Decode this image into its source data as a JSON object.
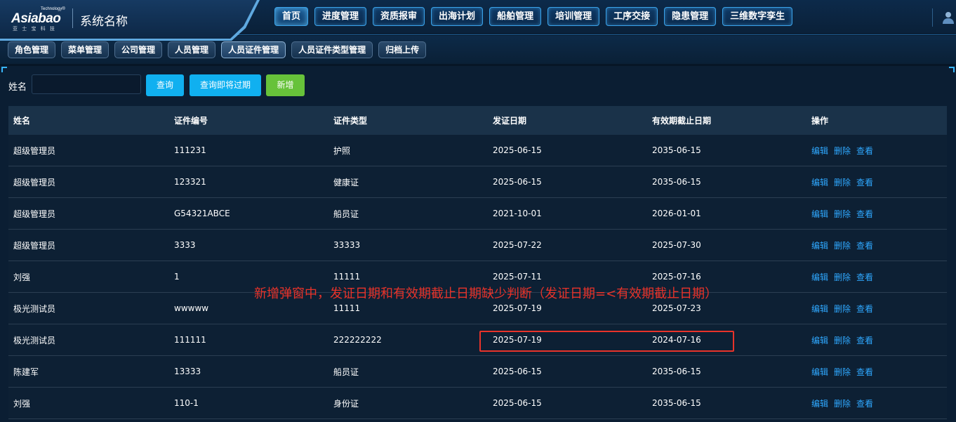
{
  "header": {
    "logo": {
      "tech": "Technology®",
      "brand": "Asiabao",
      "sub": "亚 士 宝 科 技"
    },
    "system_name": "系统名称",
    "nav": [
      {
        "label": "首页",
        "active": true
      },
      {
        "label": "进度管理"
      },
      {
        "label": "资质报审"
      },
      {
        "label": "出海计划"
      },
      {
        "label": "船舶管理"
      },
      {
        "label": "培训管理"
      },
      {
        "label": "工序交接"
      },
      {
        "label": "隐患管理"
      },
      {
        "label": "三维数字孪生"
      }
    ],
    "user_icon": "user-icon"
  },
  "sub_tabs": [
    {
      "label": "角色管理"
    },
    {
      "label": "菜单管理"
    },
    {
      "label": "公司管理"
    },
    {
      "label": "人员管理"
    },
    {
      "label": "人员证件管理",
      "active": true
    },
    {
      "label": "人员证件类型管理"
    },
    {
      "label": "归档上传"
    }
  ],
  "filter": {
    "name_label": "姓名",
    "name_value": "",
    "name_placeholder": "",
    "query_label": "查询",
    "query_expiring_label": "查询即将过期",
    "add_label": "新增"
  },
  "table": {
    "columns": [
      "姓名",
      "证件编号",
      "证件类型",
      "发证日期",
      "有效期截止日期",
      "操作"
    ],
    "actions": [
      "编辑",
      "删除",
      "查看"
    ],
    "rows": [
      [
        "超级管理员",
        "111231",
        "护照",
        "2025-06-15",
        "2035-06-15"
      ],
      [
        "超级管理员",
        "123321",
        "健康证",
        "2025-06-15",
        "2035-06-15"
      ],
      [
        "超级管理员",
        "G54321ABCE",
        "船员证",
        "2021-10-01",
        "2026-01-01"
      ],
      [
        "超级管理员",
        "3333",
        "33333",
        "2025-07-22",
        "2025-07-30"
      ],
      [
        "刘强",
        "1",
        "11111",
        "2025-07-11",
        "2025-07-16"
      ],
      [
        "极光测试员",
        "wwwww",
        "11111",
        "2025-07-19",
        "2025-07-23"
      ],
      [
        "极光测试员",
        "111111",
        "222222222",
        "2025-07-19",
        "2024-07-16"
      ],
      [
        "陈建军",
        "13333",
        "船员证",
        "2025-06-15",
        "2035-06-15"
      ],
      [
        "刘强",
        "110-1",
        "身份证",
        "2025-06-15",
        "2035-06-15"
      ]
    ]
  },
  "annotation": {
    "text": "新增弹窗中，发证日期和有效期截止日期缺少判断（发证日期=<有效期截止日期）",
    "color": "#e8332a"
  },
  "colors": {
    "accent": "#10b0f0",
    "success": "#67c23a",
    "link": "#2fa8ff",
    "background": "#071626"
  }
}
